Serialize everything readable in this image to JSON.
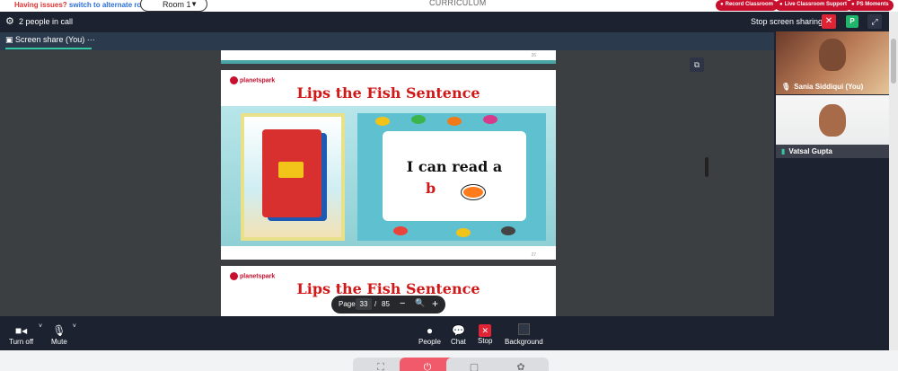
{
  "topbar": {
    "issues_text": "Having issues?",
    "alternate_link": "switch to alternate room",
    "room_select": "Room 1",
    "center_title": "CURRICULUM",
    "pills": [
      "Record Classroom",
      "Live Classroom Support",
      "PS Moments"
    ]
  },
  "header": {
    "people_count": "2 people in call",
    "stop_sharing": "Stop screen sharing",
    "p_badge": "P"
  },
  "tab": {
    "label": "Screen share (You)",
    "more": "···"
  },
  "slide": {
    "logo_text": "planetspark",
    "title": "Lips the Fish Sentence",
    "read_text": "I can read a",
    "read_letter": "b",
    "page_number_prev": "26",
    "page_number_current": "27"
  },
  "pager": {
    "label": "Page",
    "current": "33",
    "separator": "/",
    "total": "85"
  },
  "participants": [
    {
      "name": "Sania Siddiqui (You)"
    },
    {
      "name": "Vatsal Gupta"
    }
  ],
  "controls": {
    "camera_label": "Turn off",
    "mic_label": "Mute",
    "people_label": "People",
    "chat_label": "Chat",
    "stop_label": "Stop",
    "background_label": "Background"
  },
  "colors": {
    "accent": "#35c8a0",
    "danger": "#e02436",
    "brand": "#c8102e",
    "frame": "#1c2230"
  },
  "icons": [
    "gear-icon",
    "close-icon",
    "expand-icon",
    "popout-icon",
    "camera-icon",
    "mic-icon",
    "person-icon",
    "chat-icon",
    "stop-share-icon",
    "background-icon",
    "zoom-out-icon",
    "zoom-in-icon",
    "power-icon"
  ]
}
